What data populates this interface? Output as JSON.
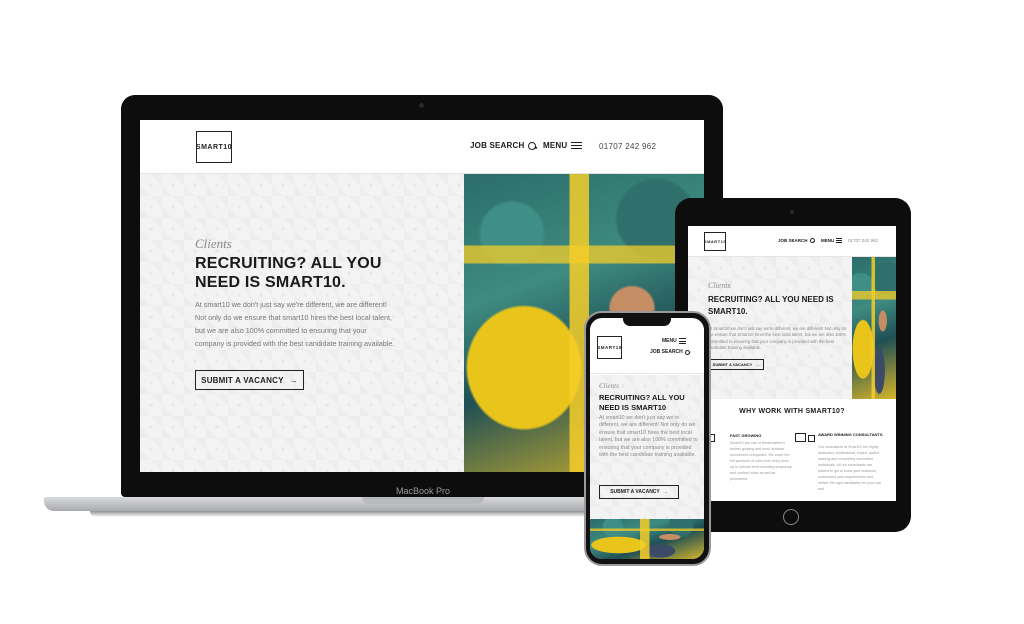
{
  "brand": {
    "logo_text": "SMART10"
  },
  "nav": {
    "job_search": "JOB SEARCH",
    "menu": "MENU",
    "phone": "01707 242 962"
  },
  "hero": {
    "kicker": "Clients",
    "headline": "RECRUITING? ALL YOU NEED IS SMART10.",
    "headline_mobile": "RECRUITING? ALL YOU NEED IS SMART10",
    "body": "At smart10 we don't just say we're different, we are different!  Not only do we ensure that smart10 hires the best local talent, but we are also 100% committed to ensuring that your company is provided with the best candidate training available.",
    "cta": "SUBMIT A VACANCY",
    "cta_arrow": "→"
  },
  "tablet": {
    "body": "At Smart10 we don't just say we're different, we are different! Not only do we ensure that Smart10 hires the best local talent, but we are also 100% committed to ensuring that your company is provided with the best candidate training available.",
    "why_title": "WHY WORK WITH SMART10?",
    "features": [
      {
        "title": "FAST GROWING",
        "body": "Smart10 are one of Hertfordshire's fastest growing and most dynamic recruitment companies. We cover the full spectrum of roles from entry level up to director level including temporary and contract roles as well as permanent."
      },
      {
        "title": "AWARD WINNING CONSULTANTS",
        "body": "Our consultants at Smart10 are highly dedicated, professional, expert, award winning and completely committed individuals. All our consultants are trained to get to know your business, understand your requirements and deliver the right candidates for your role and"
      }
    ]
  },
  "device_label": "MacBook Pro",
  "colors": {
    "accent_yellow": "#e9c51c",
    "text_dark": "#1a1a1a",
    "text_muted": "#777777"
  }
}
